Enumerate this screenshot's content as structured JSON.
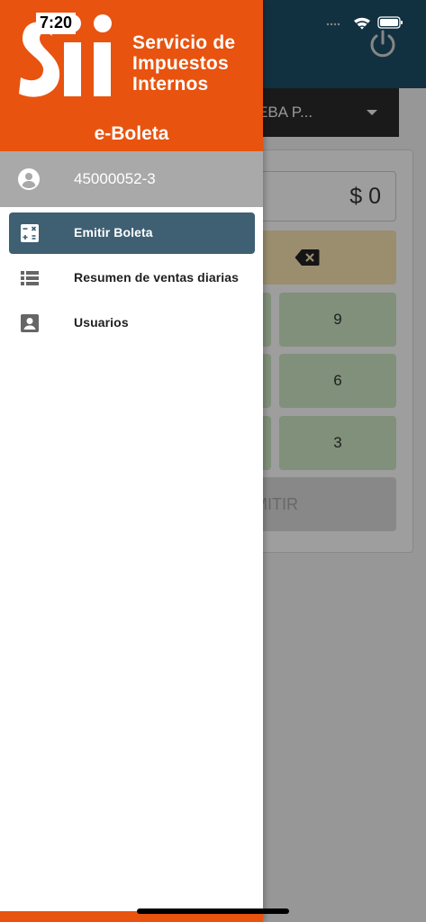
{
  "status_bar": {
    "time": "7:20"
  },
  "drawer": {
    "brand_line1": "Servicio de",
    "brand_line2": "Impuestos",
    "brand_line3": "Internos",
    "app_name": "e-Boleta",
    "user_rut": "45000052-3",
    "menu": [
      {
        "label": "Emitir Boleta",
        "icon": "calculator-icon",
        "active": true
      },
      {
        "label": "Resumen de ventas diarias",
        "icon": "list-icon",
        "active": false
      },
      {
        "label": "Usuarios",
        "icon": "contact-card-icon",
        "active": false
      }
    ]
  },
  "background_app": {
    "company_selector_text": "EBA P...",
    "amount_display": "$ 0",
    "keypad_visible": [
      "9",
      "6",
      "3"
    ],
    "emit_button_text": "MITIR"
  },
  "colors": {
    "brand_orange": "#e8530f",
    "header_teal": "#1e4f68",
    "active_item": "#3f5f73",
    "user_row": "#a9a9a9"
  }
}
